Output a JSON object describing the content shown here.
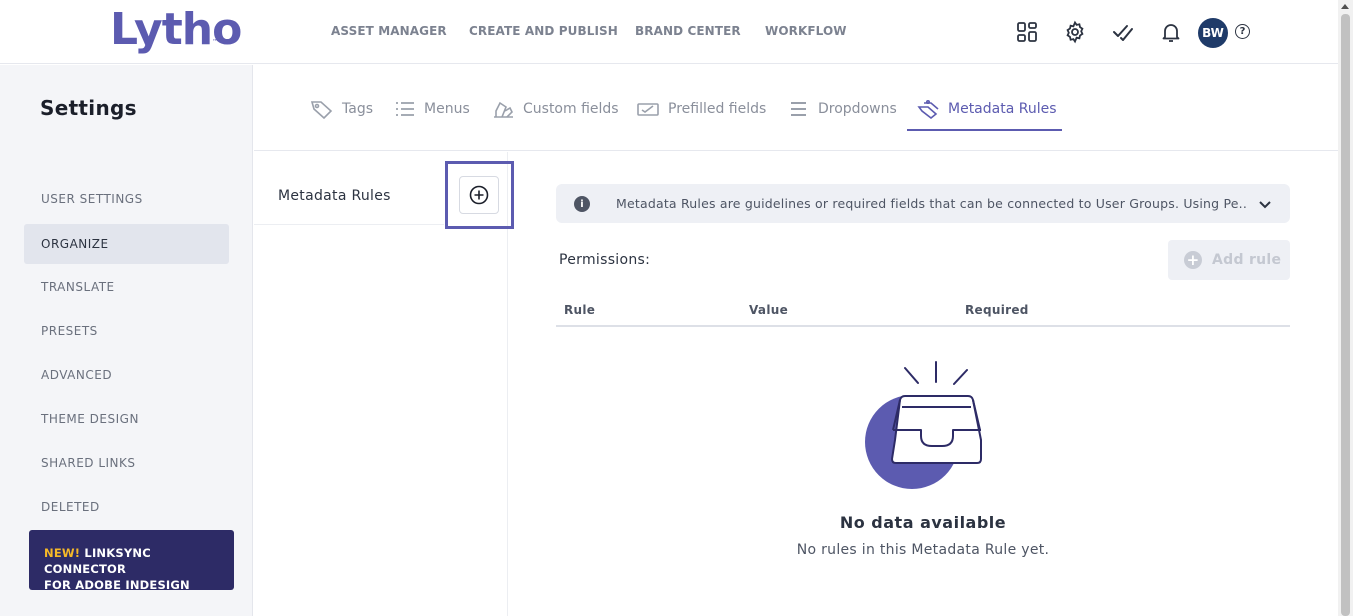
{
  "app": {
    "logo_text": "Lytho",
    "logo_tm": "™"
  },
  "topnav": {
    "items": [
      {
        "label": "ASSET MANAGER"
      },
      {
        "label": "CREATE AND PUBLISH"
      },
      {
        "label": "BRAND CENTER"
      },
      {
        "label": "WORKFLOW"
      }
    ],
    "icons": [
      "apps-grid-icon",
      "gear-icon",
      "tasks-check-icon",
      "bell-icon"
    ],
    "avatar_initials": "BW",
    "help_label": "?"
  },
  "sidebar": {
    "title": "Settings",
    "items": [
      {
        "label": "USER SETTINGS",
        "active": false
      },
      {
        "label": "ORGANIZE",
        "active": true
      },
      {
        "label": "TRANSLATE",
        "active": false
      },
      {
        "label": "PRESETS",
        "active": false
      },
      {
        "label": "ADVANCED",
        "active": false
      },
      {
        "label": "THEME DESIGN",
        "active": false
      },
      {
        "label": "SHARED LINKS",
        "active": false
      },
      {
        "label": "DELETED",
        "active": false
      }
    ],
    "promo": {
      "new_label": "NEW!",
      "line1": " LINKSYNC CONNECTOR",
      "line2": "FOR ADOBE INDESIGN"
    }
  },
  "tabs": [
    {
      "label": "Tags",
      "icon": "tag-icon",
      "active": false
    },
    {
      "label": "Menus",
      "icon": "list-icon",
      "active": false
    },
    {
      "label": "Custom fields",
      "icon": "custom-fields-icon",
      "active": false
    },
    {
      "label": "Prefilled fields",
      "icon": "prefilled-fields-icon",
      "active": false
    },
    {
      "label": "Dropdowns",
      "icon": "dropdown-lines-icon",
      "active": false
    },
    {
      "label": "Metadata Rules",
      "icon": "metadata-rules-icon",
      "active": true
    }
  ],
  "middle": {
    "title": "Metadata Rules",
    "add_icon": "plus-circle-icon"
  },
  "main": {
    "info_text": "Metadata Rules are guidelines or required fields that can be connected to User Groups. Using Pe...",
    "permissions_label": "Permissions:",
    "add_rule_label": "Add rule",
    "columns": [
      "Rule",
      "Value",
      "Required"
    ],
    "empty_title": "No data available",
    "empty_subtitle": "No rules in this Metadata Rule yet."
  },
  "colors": {
    "accent": "#5c5bb0",
    "promo_bg": "#2d2b66",
    "promo_new": "#f6b928",
    "avatar_bg": "#1f3b69"
  }
}
